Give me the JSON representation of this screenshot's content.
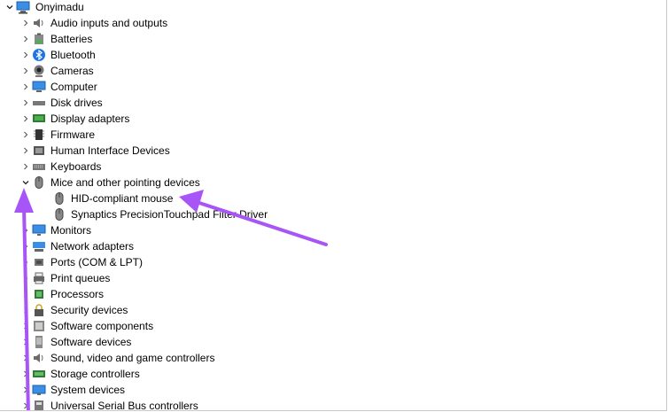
{
  "root": {
    "label": "Onyimadu",
    "expanded": true
  },
  "categories": [
    {
      "label": "Audio inputs and outputs",
      "icon": "speaker-icon"
    },
    {
      "label": "Batteries",
      "icon": "battery-icon"
    },
    {
      "label": "Bluetooth",
      "icon": "bluetooth-icon"
    },
    {
      "label": "Cameras",
      "icon": "camera-icon"
    },
    {
      "label": "Computer",
      "icon": "computer-icon"
    },
    {
      "label": "Disk drives",
      "icon": "disk-drive-icon"
    },
    {
      "label": "Display adapters",
      "icon": "display-adapter-icon"
    },
    {
      "label": "Firmware",
      "icon": "firmware-chip-icon"
    },
    {
      "label": "Human Interface Devices",
      "icon": "hid-icon"
    },
    {
      "label": "Keyboards",
      "icon": "keyboard-icon"
    },
    {
      "label": "Mice and other pointing devices",
      "icon": "mouse-icon",
      "expanded": true,
      "children": [
        {
          "label": "HID-compliant mouse",
          "icon": "mouse-icon"
        },
        {
          "label": "Synaptics PrecisionTouchpad Filter Driver",
          "icon": "mouse-icon"
        }
      ]
    },
    {
      "label": "Monitors",
      "icon": "monitor-icon"
    },
    {
      "label": "Network adapters",
      "icon": "network-adapter-icon"
    },
    {
      "label": "Ports (COM & LPT)",
      "icon": "port-icon"
    },
    {
      "label": "Print queues",
      "icon": "printer-icon"
    },
    {
      "label": "Processors",
      "icon": "processor-icon"
    },
    {
      "label": "Security devices",
      "icon": "security-device-icon"
    },
    {
      "label": "Software components",
      "icon": "software-component-icon"
    },
    {
      "label": "Software devices",
      "icon": "software-device-icon"
    },
    {
      "label": "Sound, video and game controllers",
      "icon": "sound-controller-icon"
    },
    {
      "label": "Storage controllers",
      "icon": "storage-controller-icon"
    },
    {
      "label": "System devices",
      "icon": "system-device-icon"
    },
    {
      "label": "Universal Serial Bus controllers",
      "icon": "usb-controller-icon"
    }
  ],
  "annotation_color": "#a855f7"
}
